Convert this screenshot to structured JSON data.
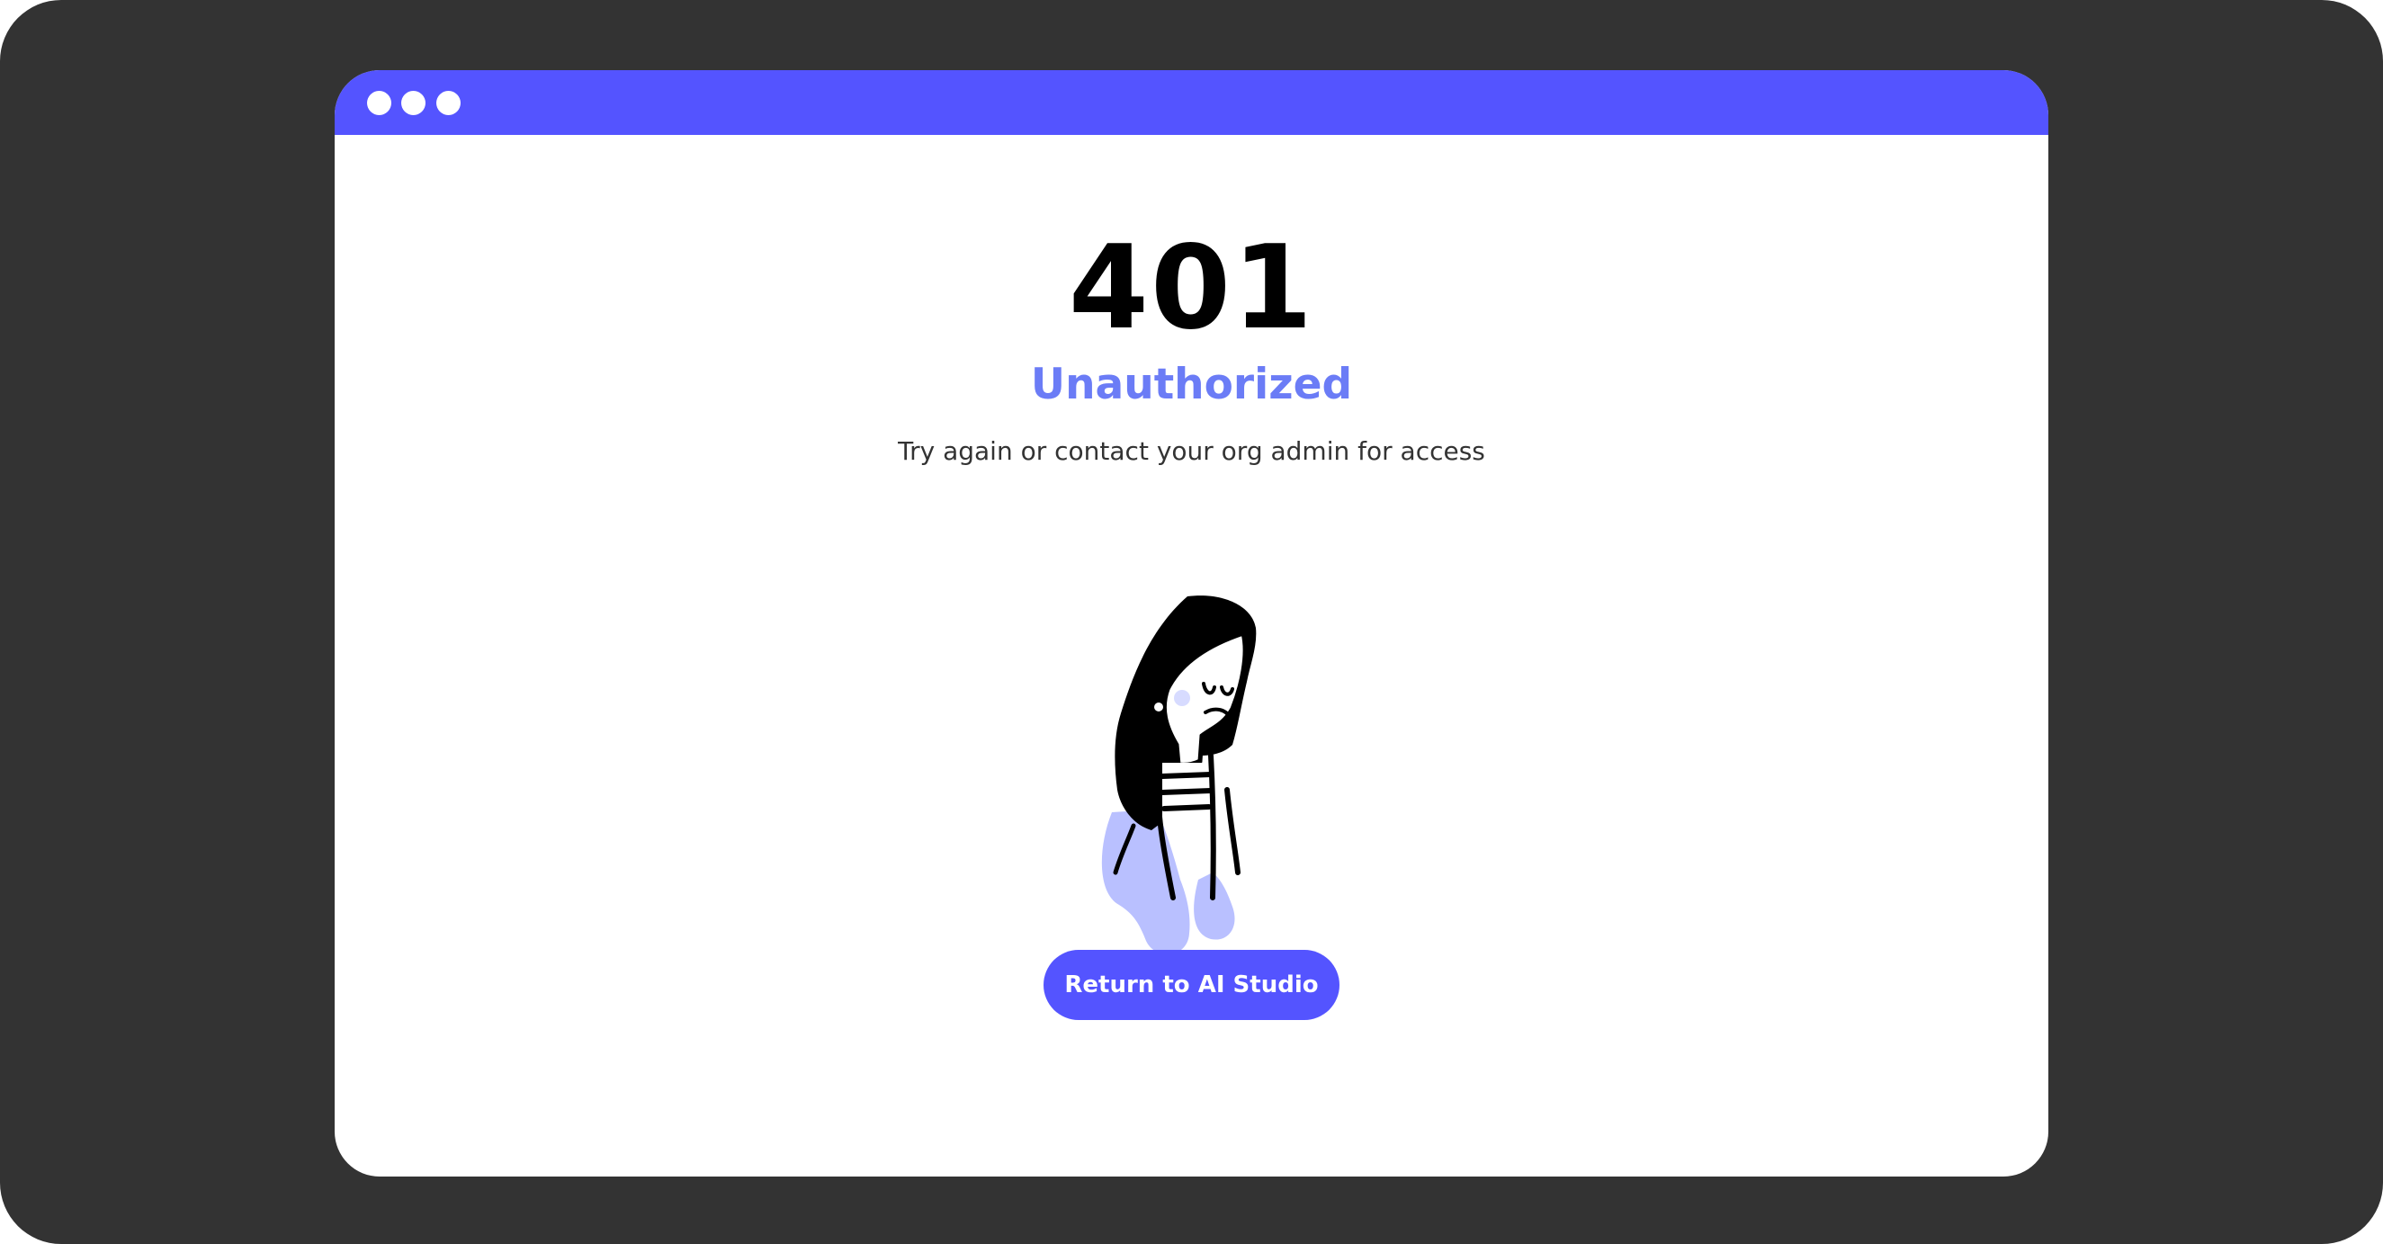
{
  "window": {
    "controls": [
      "window-dot-icon",
      "window-dot-icon",
      "window-dot-icon"
    ]
  },
  "error": {
    "code": "401",
    "status": "Unauthorized",
    "message": "Try again or contact your org admin for access"
  },
  "actions": {
    "return_label": "Return to AI Studio"
  },
  "colors": {
    "background": "#333333",
    "accent": "#5454ff",
    "status_text": "#6b7cf6",
    "illustration_fill": "#b9c0ff"
  },
  "illustration": {
    "icon": "sad-person-illustration"
  }
}
